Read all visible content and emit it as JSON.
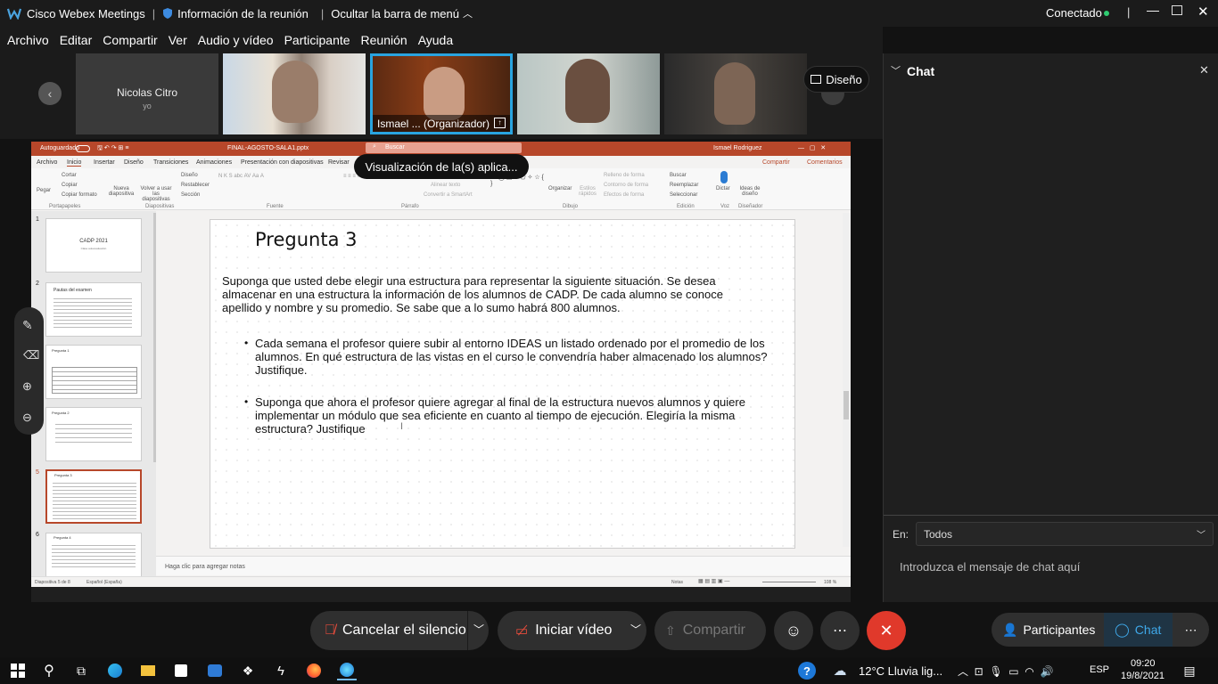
{
  "titlebar": {
    "app": "Cisco Webex Meetings",
    "info": "Información de la reunión",
    "hide_menu": "Ocultar la barra de menú",
    "status": "Conectado"
  },
  "menu": [
    "Archivo",
    "Editar",
    "Compartir",
    "Ver",
    "Audio y vídeo",
    "Participante",
    "Reunión",
    "Ayuda"
  ],
  "participants": {
    "self_name": "Nicolas Citro",
    "self_sub": "yo",
    "organizer_label": "Ismael ... (Organizador)"
  },
  "layout_button": "Diseño",
  "share_overlay": "Visualización de la(s) aplica...",
  "ppt": {
    "autosave": "Autoguardado",
    "filename": "FINAL-AGOSTO-SALA1.pptx",
    "search": "Buscar",
    "user": "Ismael Rodriguez",
    "tabs": [
      "Archivo",
      "Inicio",
      "Insertar",
      "Diseño",
      "Transiciones",
      "Animaciones",
      "Presentación con diapositivas",
      "Revisar"
    ],
    "share_btn": "Compartir",
    "comments_btn": "Comentarios",
    "ribbon_groups": [
      "Portapapeles",
      "Diapositivas",
      "Fuente",
      "Párrafo",
      "Dibujo",
      "Edición",
      "Voz",
      "Diseñador"
    ],
    "ribbon_items": {
      "cut": "Cortar",
      "copy": "Copiar",
      "format_copy": "Copiar formato",
      "paste": "Pegar",
      "new_slide": "Nueva diapositiva",
      "reuse": "Volver a usar las diapositivas",
      "layout": "Diseño",
      "reset": "Restablecer",
      "section": "Sección",
      "arrange": "Organizar",
      "quick_styles": "Estilos rápidos",
      "find": "Buscar",
      "replace": "Reemplazar",
      "select": "Seleccionar",
      "dictate": "Dictar",
      "ideas": "Ideas de diseño",
      "fill": "Relleno de forma",
      "outline": "Contorno de forma",
      "effects": "Efectos de forma",
      "align_text": "Alinear texto",
      "smartart": "Convertir a SmartArt"
    },
    "thumbs": [
      {
        "n": "1",
        "title": "CADP 2021",
        "sub": "Clase autoevaluación"
      },
      {
        "n": "2",
        "title": "Pautas del examen",
        "sub": ""
      },
      {
        "n": "3",
        "title": "Pregunta 1",
        "sub": ""
      },
      {
        "n": "4",
        "title": "Pregunta 2",
        "sub": ""
      },
      {
        "n": "5",
        "title": "Pregunta 3",
        "sub": ""
      },
      {
        "n": "6",
        "title": "Pregunta 4",
        "sub": ""
      }
    ],
    "slide": {
      "title": "Pregunta 3",
      "intro": "Suponga que usted debe elegir una estructura para representar la siguiente situación. Se desea almacenar en una estructura la información de los alumnos de CADP. De cada alumno se conoce apellido y nombre y su promedio. Se sabe que a lo sumo habrá 800 alumnos.",
      "bullet1": "Cada semana el profesor quiere subir al entorno IDEAS un listado ordenado por el promedio de los alumnos. En qué estructura de las vistas en el curso le convendría haber almacenado los alumnos? Justifique.",
      "bullet2": "Suponga que ahora el profesor quiere agregar al final de la estructura nuevos alumnos y quiere implementar un módulo que sea eficiente en cuanto al tiempo de ejecución. Elegiría la misma estructura? Justifique"
    },
    "notes": "Haga clic para agregar notas",
    "status_slide": "Diapositiva 5 de 8",
    "status_lang": "Español (España)",
    "status_notes": "Notas",
    "zoom": "108 %"
  },
  "chat": {
    "title": "Chat",
    "to_label": "En:",
    "to_value": "Todos",
    "placeholder": "Introduzca el mensaje de chat aquí"
  },
  "controls": {
    "mute": "Cancelar el silencio",
    "video": "Iniciar vídeo",
    "share": "Compartir",
    "participants": "Participantes",
    "chat": "Chat"
  },
  "taskbar": {
    "weather": "12°C  Lluvia lig...",
    "lang": "ESP",
    "time": "09:20",
    "date": "19/8/2021"
  },
  "colors": {
    "accent": "#1a9ad6",
    "end_call": "#e0392b",
    "ppt_brand": "#b7472a",
    "connected": "#2ecc71"
  }
}
